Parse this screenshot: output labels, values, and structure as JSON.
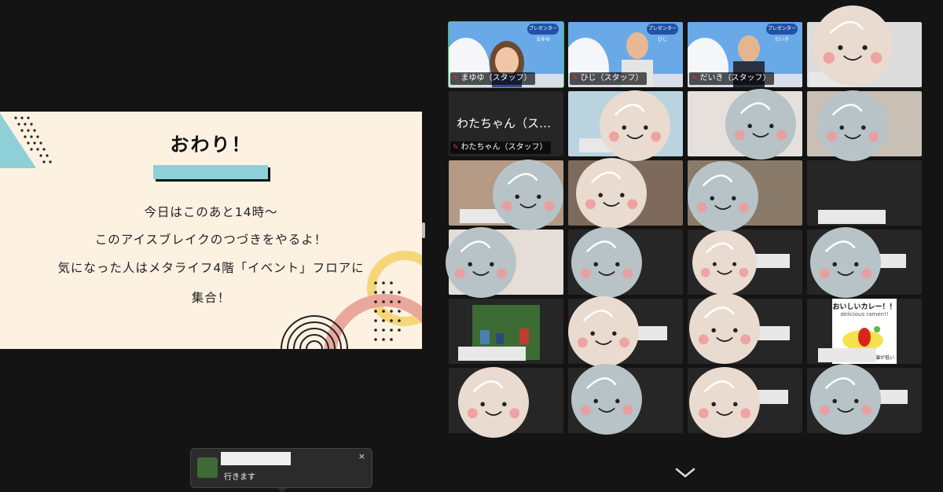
{
  "slide": {
    "title": "おわり！",
    "lines": [
      "今日はこのあと14時～",
      "このアイスブレイクのつづきをやるよ！",
      "気になった人はメタライフ4階「イベント」フロアに",
      "集合！"
    ]
  },
  "gallery": {
    "tiles": [
      {
        "name": "まゆゆ（スタッフ）",
        "badge": "プレゼンター まゆゆ",
        "role": "presenter"
      },
      {
        "name": "ひじ（スタッフ）",
        "badge": "プレゼンター ひじ",
        "role": "presenter"
      },
      {
        "name": "だいき（スタッフ）",
        "badge": "プレゼンター だいき",
        "role": "presenter"
      },
      {
        "name": ""
      },
      {
        "name": "わたちゃん（スタッフ）",
        "big_name": "わたちゃん（ス…"
      },
      {
        "name": ""
      },
      {
        "name": ""
      },
      {
        "name": ""
      },
      {
        "name": ""
      },
      {
        "name": ""
      },
      {
        "name": ""
      },
      {
        "name": ""
      },
      {
        "name": ""
      },
      {
        "name": ""
      },
      {
        "name": ""
      },
      {
        "name": ""
      },
      {
        "name": ""
      },
      {
        "name": ""
      },
      {
        "name": ""
      },
      {
        "name": ""
      },
      {
        "name": ""
      },
      {
        "name": ""
      },
      {
        "name": ""
      },
      {
        "name": ""
      }
    ],
    "card_title": "おいしいカレー！！",
    "card_subtitle": "delicious ramen!!",
    "card_note": "価値が低い"
  },
  "chat_toast": {
    "message": "行きます",
    "close_icon": "×"
  },
  "colors": {
    "active_speaker": "#2ecc40",
    "mic_muted": "#e0332b",
    "cover_blue": "#b7c3c6",
    "cover_beige": "#e9dbd0"
  }
}
